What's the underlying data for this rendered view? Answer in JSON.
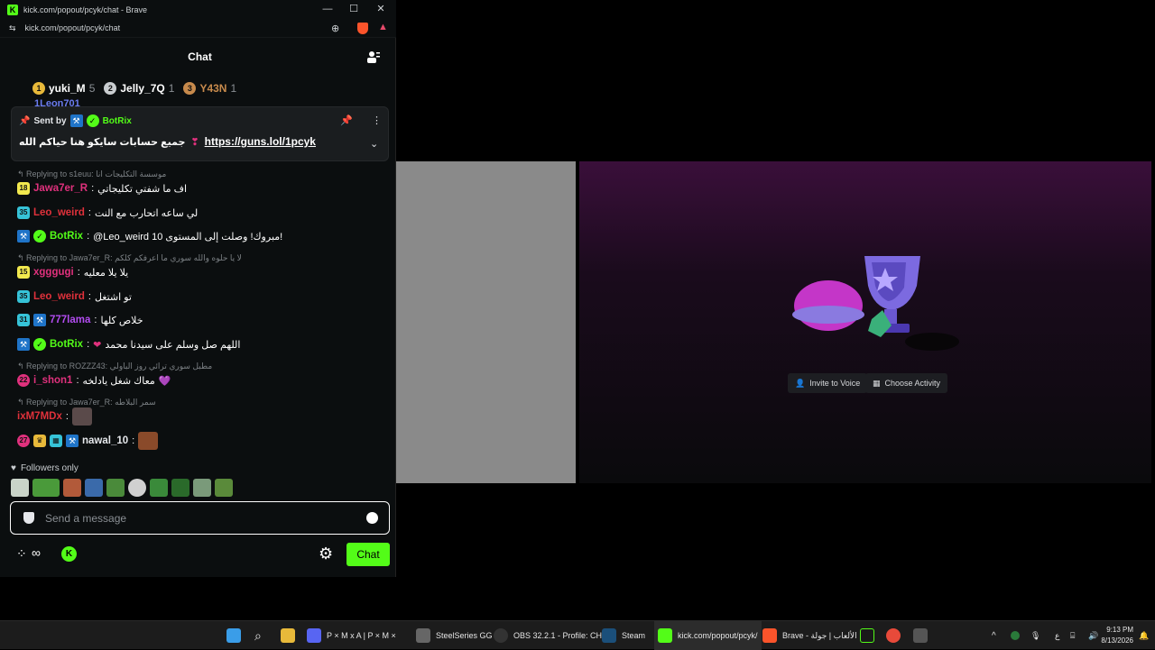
{
  "window": {
    "title": "kick.com/popout/pcyk/chat - Brave",
    "url": "kick.com/popout/pcyk/chat"
  },
  "chat": {
    "title": "Chat",
    "leaderboard": [
      {
        "rank": "1",
        "name": "yuki_M",
        "count": "5",
        "color": "#e8b93a"
      },
      {
        "rank": "2",
        "name": "Jelly_7Q",
        "count": "1",
        "color": "#c9cdd0"
      },
      {
        "rank": "3",
        "name": "Y43N",
        "count": "1",
        "color": "#c78a4c"
      }
    ],
    "pinned": {
      "sent_by_label": "Sent by",
      "sender": "BotRix",
      "text": "جميع حسابات سايكو هنا حياكم الله",
      "link": "https://guns.lol/1pcyk",
      "hidden_user": "1Leon701"
    },
    "messages": [
      {
        "type": "reply",
        "text": "Replying to s1euu: موسسة التكليجات انا"
      },
      {
        "type": "msg",
        "badge": "18",
        "badge_color": "#f2e94e",
        "user": "Jawa7er_R",
        "user_color": "#e0317d",
        "text": "اف ما شفتي تكليجاتي"
      },
      {
        "type": "msg",
        "badge": "35",
        "badge_color": "#36c3d8",
        "user": "Leo_weird",
        "user_color": "#e0313b",
        "text": "لي ساعه اتحارب مع النت"
      },
      {
        "type": "msg",
        "badge": "bot",
        "user": "BotRix",
        "user_color": "#53fc18",
        "text": "@Leo_weird 10 مبروك! وصلت إلى المستوى!"
      },
      {
        "type": "reply",
        "text": "Replying to Jawa7er_R: لا يا حلوه والله سوري ما اعرفكم كلكم"
      },
      {
        "type": "msg",
        "badge": "15",
        "badge_color": "#f2e94e",
        "user": "xgggugi",
        "user_color": "#e0317d",
        "text": "يلا يلا معليه"
      },
      {
        "type": "msg",
        "badge": "35",
        "badge_color": "#36c3d8",
        "user": "Leo_weird",
        "user_color": "#e0313b",
        "text": "تو اشتغل"
      },
      {
        "type": "msg",
        "badge": "31",
        "badge_color": "#36c3d8",
        "user": "777lama",
        "user_color": "#b24cf0",
        "text": "خلاص كلها"
      },
      {
        "type": "msg",
        "badge": "bot",
        "user": "BotRix",
        "user_color": "#53fc18",
        "text": "اللهم صل وسلم على سيدنا محمد"
      },
      {
        "type": "reply",
        "text": "Replying to ROZZZ43: مطبل سوري ترائي روز الباولي"
      },
      {
        "type": "msg",
        "badge": "22",
        "badge_color": "#e0317d",
        "user": "i_shon1",
        "user_color": "#e0317d",
        "text": "معاك شغل يادلخه"
      },
      {
        "type": "reply",
        "text": "Replying to Jawa7er_R: سمر البلاطه"
      },
      {
        "type": "msg",
        "badge": "",
        "user": "ixM7MDx",
        "user_color": "#e0313b",
        "text": ""
      },
      {
        "type": "msg",
        "badge": "27",
        "badge_color": "#e0317d",
        "user": "nawal_10",
        "user_color": "#e5e7eb",
        "text": ""
      }
    ],
    "followers_only": "Followers only",
    "input_placeholder": "Send a message",
    "send_label": "Chat"
  },
  "activity": {
    "invite_label": "Invite to Voice",
    "choose_label": "Choose Activity"
  },
  "taskbar": {
    "items": [
      {
        "label": "P × M x A | P × M ×",
        "color": "#5865f2"
      },
      {
        "label": "SteelSeries GG",
        "color": "#e5e5e5"
      },
      {
        "label": "OBS 32.2.1 - Profile: CH/",
        "color": "#e5e5e5"
      },
      {
        "label": "Steam",
        "color": "#1b8fd6"
      },
      {
        "label": "kick.com/popout/pcyk/",
        "color": "#53fc18"
      },
      {
        "label": "Brave - الألعاب | جولة",
        "color": "#fb542b"
      }
    ],
    "time": "9:13 PM",
    "date": "8/13/2026",
    "lang": "ع"
  }
}
